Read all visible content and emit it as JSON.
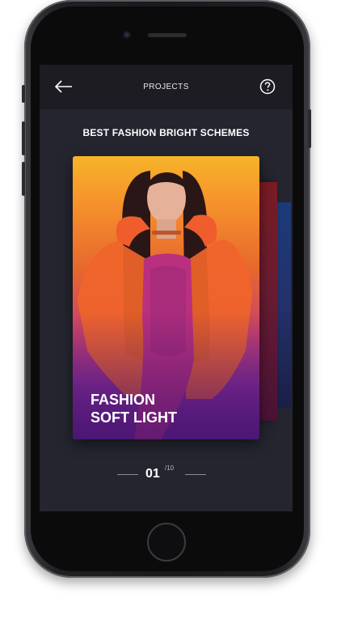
{
  "header": {
    "title": "PROJECTS"
  },
  "section": {
    "title": "BEST FASHION BRIGHT SCHEMES"
  },
  "card": {
    "line1": "FASHION",
    "line2": "SOFT LIGHT"
  },
  "pager": {
    "current": "01",
    "total": "/10"
  },
  "icons": {
    "back": "arrow-left-icon",
    "help": "question-circle-icon"
  }
}
